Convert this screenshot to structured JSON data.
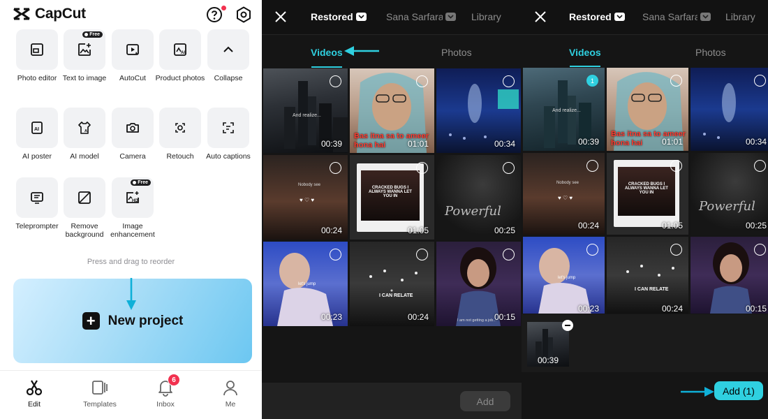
{
  "app": {
    "name": "CapCut"
  },
  "tools": [
    {
      "label": "Photo editor",
      "free": false
    },
    {
      "label": "Text to image",
      "free": true
    },
    {
      "label": "AutoCut",
      "free": false
    },
    {
      "label": "Product photos",
      "free": false
    },
    {
      "label": "Collapse",
      "free": false
    },
    {
      "label": "AI poster",
      "free": false
    },
    {
      "label": "AI model",
      "free": false
    },
    {
      "label": "Camera",
      "free": false
    },
    {
      "label": "Retouch",
      "free": false
    },
    {
      "label": "Auto captions",
      "free": false
    },
    {
      "label": "Teleprompter",
      "free": false
    },
    {
      "label": "Remove background",
      "free": false
    },
    {
      "label": "Image enhancement",
      "free": true
    }
  ],
  "free_badge": "Free",
  "reorder_hint": "Press and drag to reorder",
  "new_project_label": "New project",
  "nav": [
    {
      "label": "Edit",
      "active": true
    },
    {
      "label": "Templates",
      "active": false
    },
    {
      "label": "Inbox",
      "active": false,
      "badge": "6"
    },
    {
      "label": "Me",
      "active": false
    }
  ],
  "picker": {
    "albums": [
      "Restored",
      "Sana Sarfaraz",
      "Library"
    ],
    "media_tabs": [
      "Videos",
      "Photos"
    ],
    "add_label": "Add",
    "add_selected_label": "Add (1)",
    "selected_index": "1",
    "tray_duration": "00:39",
    "videos": [
      {
        "duration": "00:39",
        "caption": "",
        "overlay": "And realize..."
      },
      {
        "duration": "01:01",
        "caption": "Bas itna sa to ameer hona hai",
        "overlay": ""
      },
      {
        "duration": "00:34",
        "caption": "",
        "overlay": ""
      },
      {
        "duration": "00:24",
        "caption": "",
        "overlay": "Nobody see"
      },
      {
        "duration": "01:05",
        "caption": "",
        "overlay": "CRACKED BUGS I ALWAYS WANNA LET YOU IN"
      },
      {
        "duration": "00:25",
        "caption": "",
        "overlay": "Powerful"
      },
      {
        "duration": "00:23",
        "caption": "",
        "overlay": "let's jump"
      },
      {
        "duration": "00:24",
        "caption": "",
        "overlay": "I CAN RELATE"
      },
      {
        "duration": "00:15",
        "caption": "",
        "overlay": "I am not getting a job..."
      }
    ]
  },
  "colors": {
    "accent": "#2fd0e0",
    "badge_red": "#f2314f",
    "dark_bg": "#151515",
    "caption_red": "#ff3b30"
  }
}
